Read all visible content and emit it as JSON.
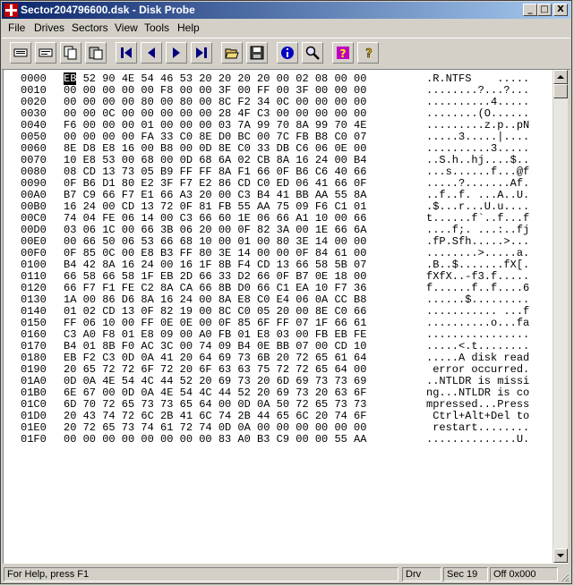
{
  "window": {
    "title": "Sector204796600.dsk - Disk Probe"
  },
  "titlebar_buttons": {
    "minimize": "_",
    "maximize": "□",
    "close": "X"
  },
  "menu": [
    "File",
    "Drives",
    "Sectors",
    "View",
    "Tools",
    "Help"
  ],
  "toolbar": {
    "buttons": [
      "read-sector-icon",
      "write-sector-icon",
      "copy-icon",
      "paste-icon",
      "first-sector-icon",
      "previous-sector-icon",
      "next-sector-icon",
      "last-sector-icon",
      "open-file-icon",
      "save-file-icon",
      "info-icon",
      "search-icon",
      "help-icon",
      "context-help-icon"
    ]
  },
  "hexview": {
    "rows": [
      {
        "offset": "0000",
        "hex": "EB 52 90 4E 54 46 53 20 20 20 20 00 02 08 00 00",
        "ascii": ".R.NTFS    ....."
      },
      {
        "offset": "0010",
        "hex": "00 00 00 00 00 F8 00 00 3F 00 FF 00 3F 00 00 00",
        "ascii": "........?...?..."
      },
      {
        "offset": "0020",
        "hex": "00 00 00 00 80 00 80 00 8C F2 34 0C 00 00 00 00",
        "ascii": "..........4....."
      },
      {
        "offset": "0030",
        "hex": "00 00 0C 00 00 00 00 00 28 4F C3 00 00 00 00 00",
        "ascii": "........(O......"
      },
      {
        "offset": "0040",
        "hex": "F6 00 00 00 01 00 00 00 03 7A 99 70 8A 99 70 4E",
        "ascii": ".........z.p..pN"
      },
      {
        "offset": "0050",
        "hex": "00 00 00 00 FA 33 C0 8E D0 BC 00 7C FB B8 C0 07",
        "ascii": ".....3.....|...."
      },
      {
        "offset": "0060",
        "hex": "8E D8 E8 16 00 B8 00 0D 8E C0 33 DB C6 06 0E 00",
        "ascii": "..........3....."
      },
      {
        "offset": "0070",
        "hex": "10 E8 53 00 68 00 0D 68 6A 02 CB 8A 16 24 00 B4",
        "ascii": "..S.h..hj....$.."
      },
      {
        "offset": "0080",
        "hex": "08 CD 13 73 05 B9 FF FF 8A F1 66 0F B6 C6 40 66",
        "ascii": "...s......f...@f"
      },
      {
        "offset": "0090",
        "hex": "0F B6 D1 80 E2 3F F7 E2 86 CD C0 ED 06 41 66 0F",
        "ascii": ".....?.......Af."
      },
      {
        "offset": "00A0",
        "hex": "B7 C9 66 F7 E1 66 A3 20 00 C3 B4 41 BB AA 55 8A",
        "ascii": "..f..f. ...A..U."
      },
      {
        "offset": "00B0",
        "hex": "16 24 00 CD 13 72 0F 81 FB 55 AA 75 09 F6 C1 01",
        "ascii": ".$...r...U.u...."
      },
      {
        "offset": "00C0",
        "hex": "74 04 FE 06 14 00 C3 66 60 1E 06 66 A1 10 00 66",
        "ascii": "t......f`..f...f"
      },
      {
        "offset": "00D0",
        "hex": "03 06 1C 00 66 3B 06 20 00 0F 82 3A 00 1E 66 6A",
        "ascii": "....f;. ...:..fj"
      },
      {
        "offset": "00E0",
        "hex": "00 66 50 06 53 66 68 10 00 01 00 80 3E 14 00 00",
        "ascii": ".fP.Sfh.....>..."
      },
      {
        "offset": "00F0",
        "hex": "0F 85 0C 00 E8 B3 FF 80 3E 14 00 00 0F 84 61 00",
        "ascii": "........>.....a."
      },
      {
        "offset": "0100",
        "hex": "B4 42 8A 16 24 00 16 1F 8B F4 CD 13 66 58 5B 07",
        "ascii": ".B..$.......fX[."
      },
      {
        "offset": "0110",
        "hex": "66 58 66 58 1F EB 2D 66 33 D2 66 0F B7 0E 18 00",
        "ascii": "fXfX..-f3.f....."
      },
      {
        "offset": "0120",
        "hex": "66 F7 F1 FE C2 8A CA 66 8B D0 66 C1 EA 10 F7 36",
        "ascii": "f......f..f....6"
      },
      {
        "offset": "0130",
        "hex": "1A 00 86 D6 8A 16 24 00 8A E8 C0 E4 06 0A CC B8",
        "ascii": "......$........."
      },
      {
        "offset": "0140",
        "hex": "01 02 CD 13 0F 82 19 00 8C C0 05 20 00 8E C0 66",
        "ascii": "........... ...f"
      },
      {
        "offset": "0150",
        "hex": "FF 06 10 00 FF 0E 0E 00 0F 85 6F FF 07 1F 66 61",
        "ascii": "..........o...fa"
      },
      {
        "offset": "0160",
        "hex": "C3 A0 F8 01 E8 09 00 A0 FB 01 E8 03 00 FB EB FE",
        "ascii": "................"
      },
      {
        "offset": "0170",
        "hex": "B4 01 8B F0 AC 3C 00 74 09 B4 0E BB 07 00 CD 10",
        "ascii": ".....<.t........"
      },
      {
        "offset": "0180",
        "hex": "EB F2 C3 0D 0A 41 20 64 69 73 6B 20 72 65 61 64",
        "ascii": ".....A disk read"
      },
      {
        "offset": "0190",
        "hex": "20 65 72 72 6F 72 20 6F 63 63 75 72 72 65 64 00",
        "ascii": " error occurred."
      },
      {
        "offset": "01A0",
        "hex": "0D 0A 4E 54 4C 44 52 20 69 73 20 6D 69 73 73 69",
        "ascii": "..NTLDR is missi"
      },
      {
        "offset": "01B0",
        "hex": "6E 67 00 0D 0A 4E 54 4C 44 52 20 69 73 20 63 6F",
        "ascii": "ng...NTLDR is co"
      },
      {
        "offset": "01C0",
        "hex": "6D 70 72 65 73 73 65 64 00 0D 0A 50 72 65 73 73",
        "ascii": "mpressed...Press"
      },
      {
        "offset": "01D0",
        "hex": "20 43 74 72 6C 2B 41 6C 74 2B 44 65 6C 20 74 6F",
        "ascii": " Ctrl+Alt+Del to"
      },
      {
        "offset": "01E0",
        "hex": "20 72 65 73 74 61 72 74 0D 0A 00 00 00 00 00 00",
        "ascii": " restart........"
      },
      {
        "offset": "01F0",
        "hex": "00 00 00 00 00 00 00 00 83 A0 B3 C9 00 00 55 AA",
        "ascii": "..............U."
      }
    ]
  },
  "status": {
    "help": "For Help, press F1",
    "drive": "Drv",
    "sector": "Sec 19",
    "offset": "Off 0x000"
  }
}
